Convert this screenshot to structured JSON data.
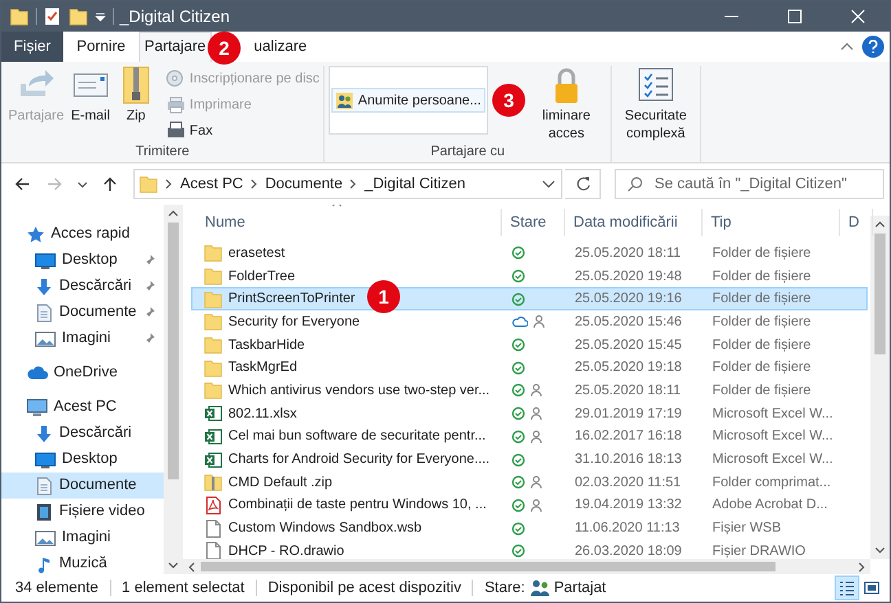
{
  "window": {
    "title": "_Digital Citizen"
  },
  "ribbon_tabs": [
    {
      "label": "Fișier",
      "kind": "file",
      "selected": false
    },
    {
      "label": "Pornire",
      "kind": "tab",
      "selected": false
    },
    {
      "label": "Partajare",
      "kind": "tab",
      "selected": true
    },
    {
      "label": "ualizare",
      "kind": "tab",
      "selected": false
    }
  ],
  "ribbon_groups": [
    {
      "label": "Trimitere",
      "items": [
        {
          "kind": "big",
          "label": "Partajare",
          "disabled": true
        },
        {
          "kind": "big",
          "label": "E-mail",
          "disabled": false
        },
        {
          "kind": "big",
          "label": "Zip",
          "disabled": false
        },
        {
          "kind": "stack",
          "items": [
            {
              "label": "Inscripționare pe disc",
              "disabled": true
            },
            {
              "label": "Imprimare",
              "disabled": true
            },
            {
              "label": "Fax",
              "disabled": false
            }
          ]
        }
      ]
    },
    {
      "label": "Partajare cu",
      "items": [
        {
          "kind": "list",
          "entries": [
            "Anumite persoane..."
          ]
        },
        {
          "kind": "big",
          "label": "liminare acces",
          "disabled": false
        }
      ]
    },
    {
      "items": [
        {
          "kind": "big",
          "label": "Securitate complexă",
          "disabled": false
        }
      ]
    }
  ],
  "address_bar": {
    "path": [
      "Acest PC",
      "Documente",
      "_Digital Citizen"
    ]
  },
  "search": {
    "placeholder": "Se caută în \"_Digital Citizen\""
  },
  "sidebar": {
    "items": [
      {
        "label": "Acces rapid",
        "kind": "star",
        "selected": false,
        "children": [
          {
            "label": "Desktop",
            "kind": "desktop",
            "selected": false,
            "pinned": true
          },
          {
            "label": "Descărcări",
            "kind": "download",
            "selected": false,
            "pinned": true
          },
          {
            "label": "Documente",
            "kind": "document",
            "selected": false,
            "pinned": true
          },
          {
            "label": "Imagini",
            "kind": "pictures",
            "selected": false,
            "pinned": true
          }
        ]
      },
      {
        "label": "OneDrive",
        "kind": "cloud",
        "selected": false
      },
      {
        "label": "Acest PC",
        "kind": "pc",
        "selected": false,
        "children": [
          {
            "label": "Descărcări",
            "kind": "download",
            "selected": false,
            "pinned": false
          },
          {
            "label": "Desktop",
            "kind": "desktop",
            "selected": false,
            "pinned": false
          },
          {
            "label": "Documente",
            "kind": "document",
            "selected": true,
            "pinned": false
          },
          {
            "label": "Fișiere video",
            "kind": "video",
            "selected": false,
            "pinned": false
          },
          {
            "label": "Imagini",
            "kind": "pictures",
            "selected": false,
            "pinned": false
          },
          {
            "label": "Muzică",
            "kind": "music",
            "selected": false,
            "pinned": false
          }
        ]
      }
    ]
  },
  "table": {
    "columns": [
      "Nume",
      "Stare",
      "Data modificării",
      "Tip",
      "D"
    ],
    "rows": [
      {
        "name": "erasetest",
        "kind": "folder",
        "synced": true,
        "shared": false,
        "date": "25.05.2020 18:11",
        "file_type": "Folder de fișiere",
        "selected": false
      },
      {
        "name": "FolderTree",
        "kind": "folder",
        "synced": true,
        "shared": false,
        "date": "25.05.2020 19:48",
        "file_type": "Folder de fișiere",
        "selected": false
      },
      {
        "name": "PrintScreenToPrinter",
        "kind": "folder",
        "synced": true,
        "shared": false,
        "date": "25.05.2020 19:16",
        "file_type": "Folder de fișiere",
        "selected": true
      },
      {
        "name": "Security for Everyone",
        "kind": "folder",
        "synced": false,
        "shared": true,
        "date": "25.05.2020 15:46",
        "file_type": "Folder de fișiere",
        "selected": false
      },
      {
        "name": "TaskbarHide",
        "kind": "folder",
        "synced": true,
        "shared": false,
        "date": "25.05.2020 15:45",
        "file_type": "Folder de fișiere",
        "selected": false
      },
      {
        "name": "TaskMgrEd",
        "kind": "folder",
        "synced": true,
        "shared": false,
        "date": "25.05.2020 19:18",
        "file_type": "Folder de fișiere",
        "selected": false
      },
      {
        "name": "Which antivirus vendors use two-step ver...",
        "kind": "folder",
        "synced": true,
        "shared": true,
        "date": "25.05.2020 18:11",
        "file_type": "Folder de fișiere",
        "selected": false
      },
      {
        "name": "802.11.xlsx",
        "kind": "excel",
        "synced": true,
        "shared": true,
        "date": "29.01.2019 17:19",
        "file_type": "Microsoft Excel W...",
        "selected": false
      },
      {
        "name": "Cel mai bun software de securitate pentr...",
        "kind": "excel",
        "synced": true,
        "shared": true,
        "date": "16.02.2017 16:18",
        "file_type": "Microsoft Excel W...",
        "selected": false
      },
      {
        "name": "Charts for Android Security for Everyone....",
        "kind": "excel",
        "synced": true,
        "shared": false,
        "date": "31.10.2016 18:13",
        "file_type": "Microsoft Excel W...",
        "selected": false
      },
      {
        "name": "CMD Default .zip",
        "kind": "zip",
        "synced": true,
        "shared": true,
        "date": "02.03.2020 11:51",
        "file_type": "Folder comprimat...",
        "selected": false
      },
      {
        "name": "Combinații de taste pentru Windows 10, ...",
        "kind": "pdf",
        "synced": true,
        "shared": true,
        "date": "19.04.2019 13:32",
        "file_type": "Adobe Acrobat D...",
        "selected": false
      },
      {
        "name": "Custom Windows Sandbox.wsb",
        "kind": "file",
        "synced": true,
        "shared": false,
        "date": "11.06.2020 11:13",
        "file_type": "Fișier WSB",
        "selected": false
      },
      {
        "name": "DHCP - RO.drawio",
        "kind": "file",
        "synced": true,
        "shared": false,
        "date": "26.03.2020 18:09",
        "file_type": "Fișier DRAWIO",
        "selected": false
      }
    ]
  },
  "status_bar": {
    "count": "34 elemente",
    "selection": "1 element selectat",
    "availability": "Disponibil pe acest dispozitiv",
    "state_label": "Stare:",
    "state": "Partajat",
    "views": [
      {
        "kind": "details",
        "selected": true
      },
      {
        "kind": "large",
        "selected": false
      }
    ]
  },
  "callouts": [
    "1",
    "2",
    "3"
  ]
}
